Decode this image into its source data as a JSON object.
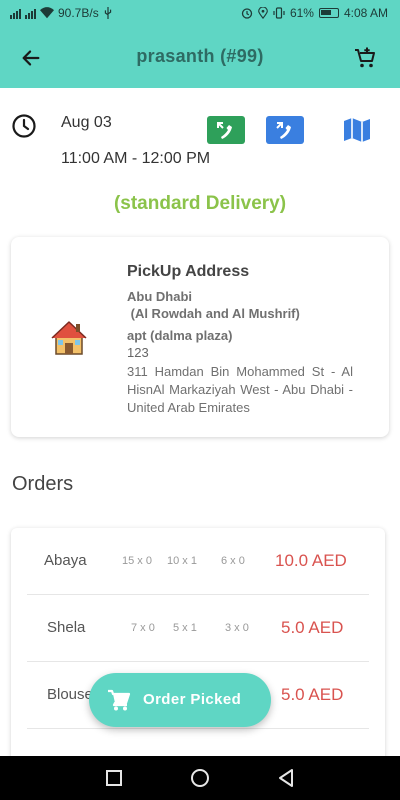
{
  "status_bar": {
    "net_speed": "90.7B/s",
    "battery": "61%",
    "time": "4:08 AM",
    "icons": [
      "signal-icon",
      "wifi-icon",
      "usb-icon",
      "alarm-icon",
      "location-icon",
      "vibrate-icon",
      "battery-icon"
    ]
  },
  "header": {
    "title": "prasanth  (#99)",
    "back_icon": "arrow-back-icon",
    "cart_icon": "cart-add-icon"
  },
  "schedule": {
    "date": "Aug 03",
    "time": "11:00 AM - 12:00 PM",
    "clock_icon": "clock-icon",
    "actions": [
      "call-icon",
      "call-icon",
      "map-icon"
    ]
  },
  "delivery_type": "(standard Delivery)",
  "pickup": {
    "heading": "PickUp Address",
    "city": "Abu Dhabi",
    "area": " (Al Rowdah and Al Mushrif)",
    "apt": "apt (dalma plaza)",
    "number": "123",
    "address": " 311 Hamdan Bin Mohammed St - Al HisnAl Markaziyah West - Abu Dhabi - United Arab Emirates"
  },
  "orders": {
    "heading": "Orders",
    "items": [
      {
        "name": "Abaya",
        "q1": "15 x 0",
        "q2": "10 x 1",
        "q3": "6 x 0",
        "price": "10.0 AED"
      },
      {
        "name": "Shela",
        "q1": "7 x 0",
        "q2": "5 x 1",
        "q3": "3 x 0",
        "price": "5.0 AED"
      },
      {
        "name": "Blouse",
        "q1": "",
        "q2": "",
        "q3": "",
        "price": "5.0 AED"
      }
    ]
  },
  "fab": {
    "label": "Order Picked",
    "icon": "cart-icon"
  },
  "colors": {
    "primary": "#5fd6c4",
    "title": "#2e6b63",
    "delivery": "#8bc34a",
    "price": "#d9534f",
    "call_green": "#2ea05a",
    "call_blue": "#3a7fe0",
    "map": "#3a7fe0"
  }
}
